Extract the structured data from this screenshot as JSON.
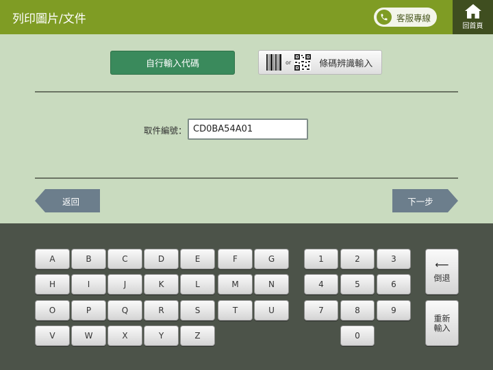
{
  "header": {
    "title": "列印圖片/文件",
    "hotline_label": "客服專線",
    "home_label": "回首頁"
  },
  "modes": {
    "manual_label": "自行輸入代碼",
    "or_text": "or",
    "barcode_label": "條碼辨識輸入"
  },
  "form": {
    "field_label": "取件編號：",
    "field_value": "CD0BA54A01"
  },
  "nav": {
    "back_label": "返回",
    "next_label": "下一步"
  },
  "keyboard": {
    "letters_row1": [
      "A",
      "B",
      "C",
      "D",
      "E",
      "F",
      "G"
    ],
    "letters_row2": [
      "H",
      "I",
      "J",
      "K",
      "L",
      "M",
      "N"
    ],
    "letters_row3": [
      "O",
      "P",
      "Q",
      "R",
      "S",
      "T",
      "U"
    ],
    "letters_row4": [
      "V",
      "W",
      "X",
      "Y",
      "Z"
    ],
    "digits_row1": [
      "1",
      "2",
      "3"
    ],
    "digits_row2": [
      "4",
      "5",
      "6"
    ],
    "digits_row3": [
      "7",
      "8",
      "9"
    ],
    "digits_row4": [
      "0"
    ],
    "backspace_label": "倒退",
    "reset_label_line1": "重新",
    "reset_label_line2": "輸入"
  },
  "colors": {
    "header": "#7f9c24",
    "home": "#3f4e20",
    "manual_button": "#3a8a5c",
    "page_background": "#c9dbbf",
    "keyboard_background": "#4c5349",
    "nav_button": "#6c7e8c"
  }
}
